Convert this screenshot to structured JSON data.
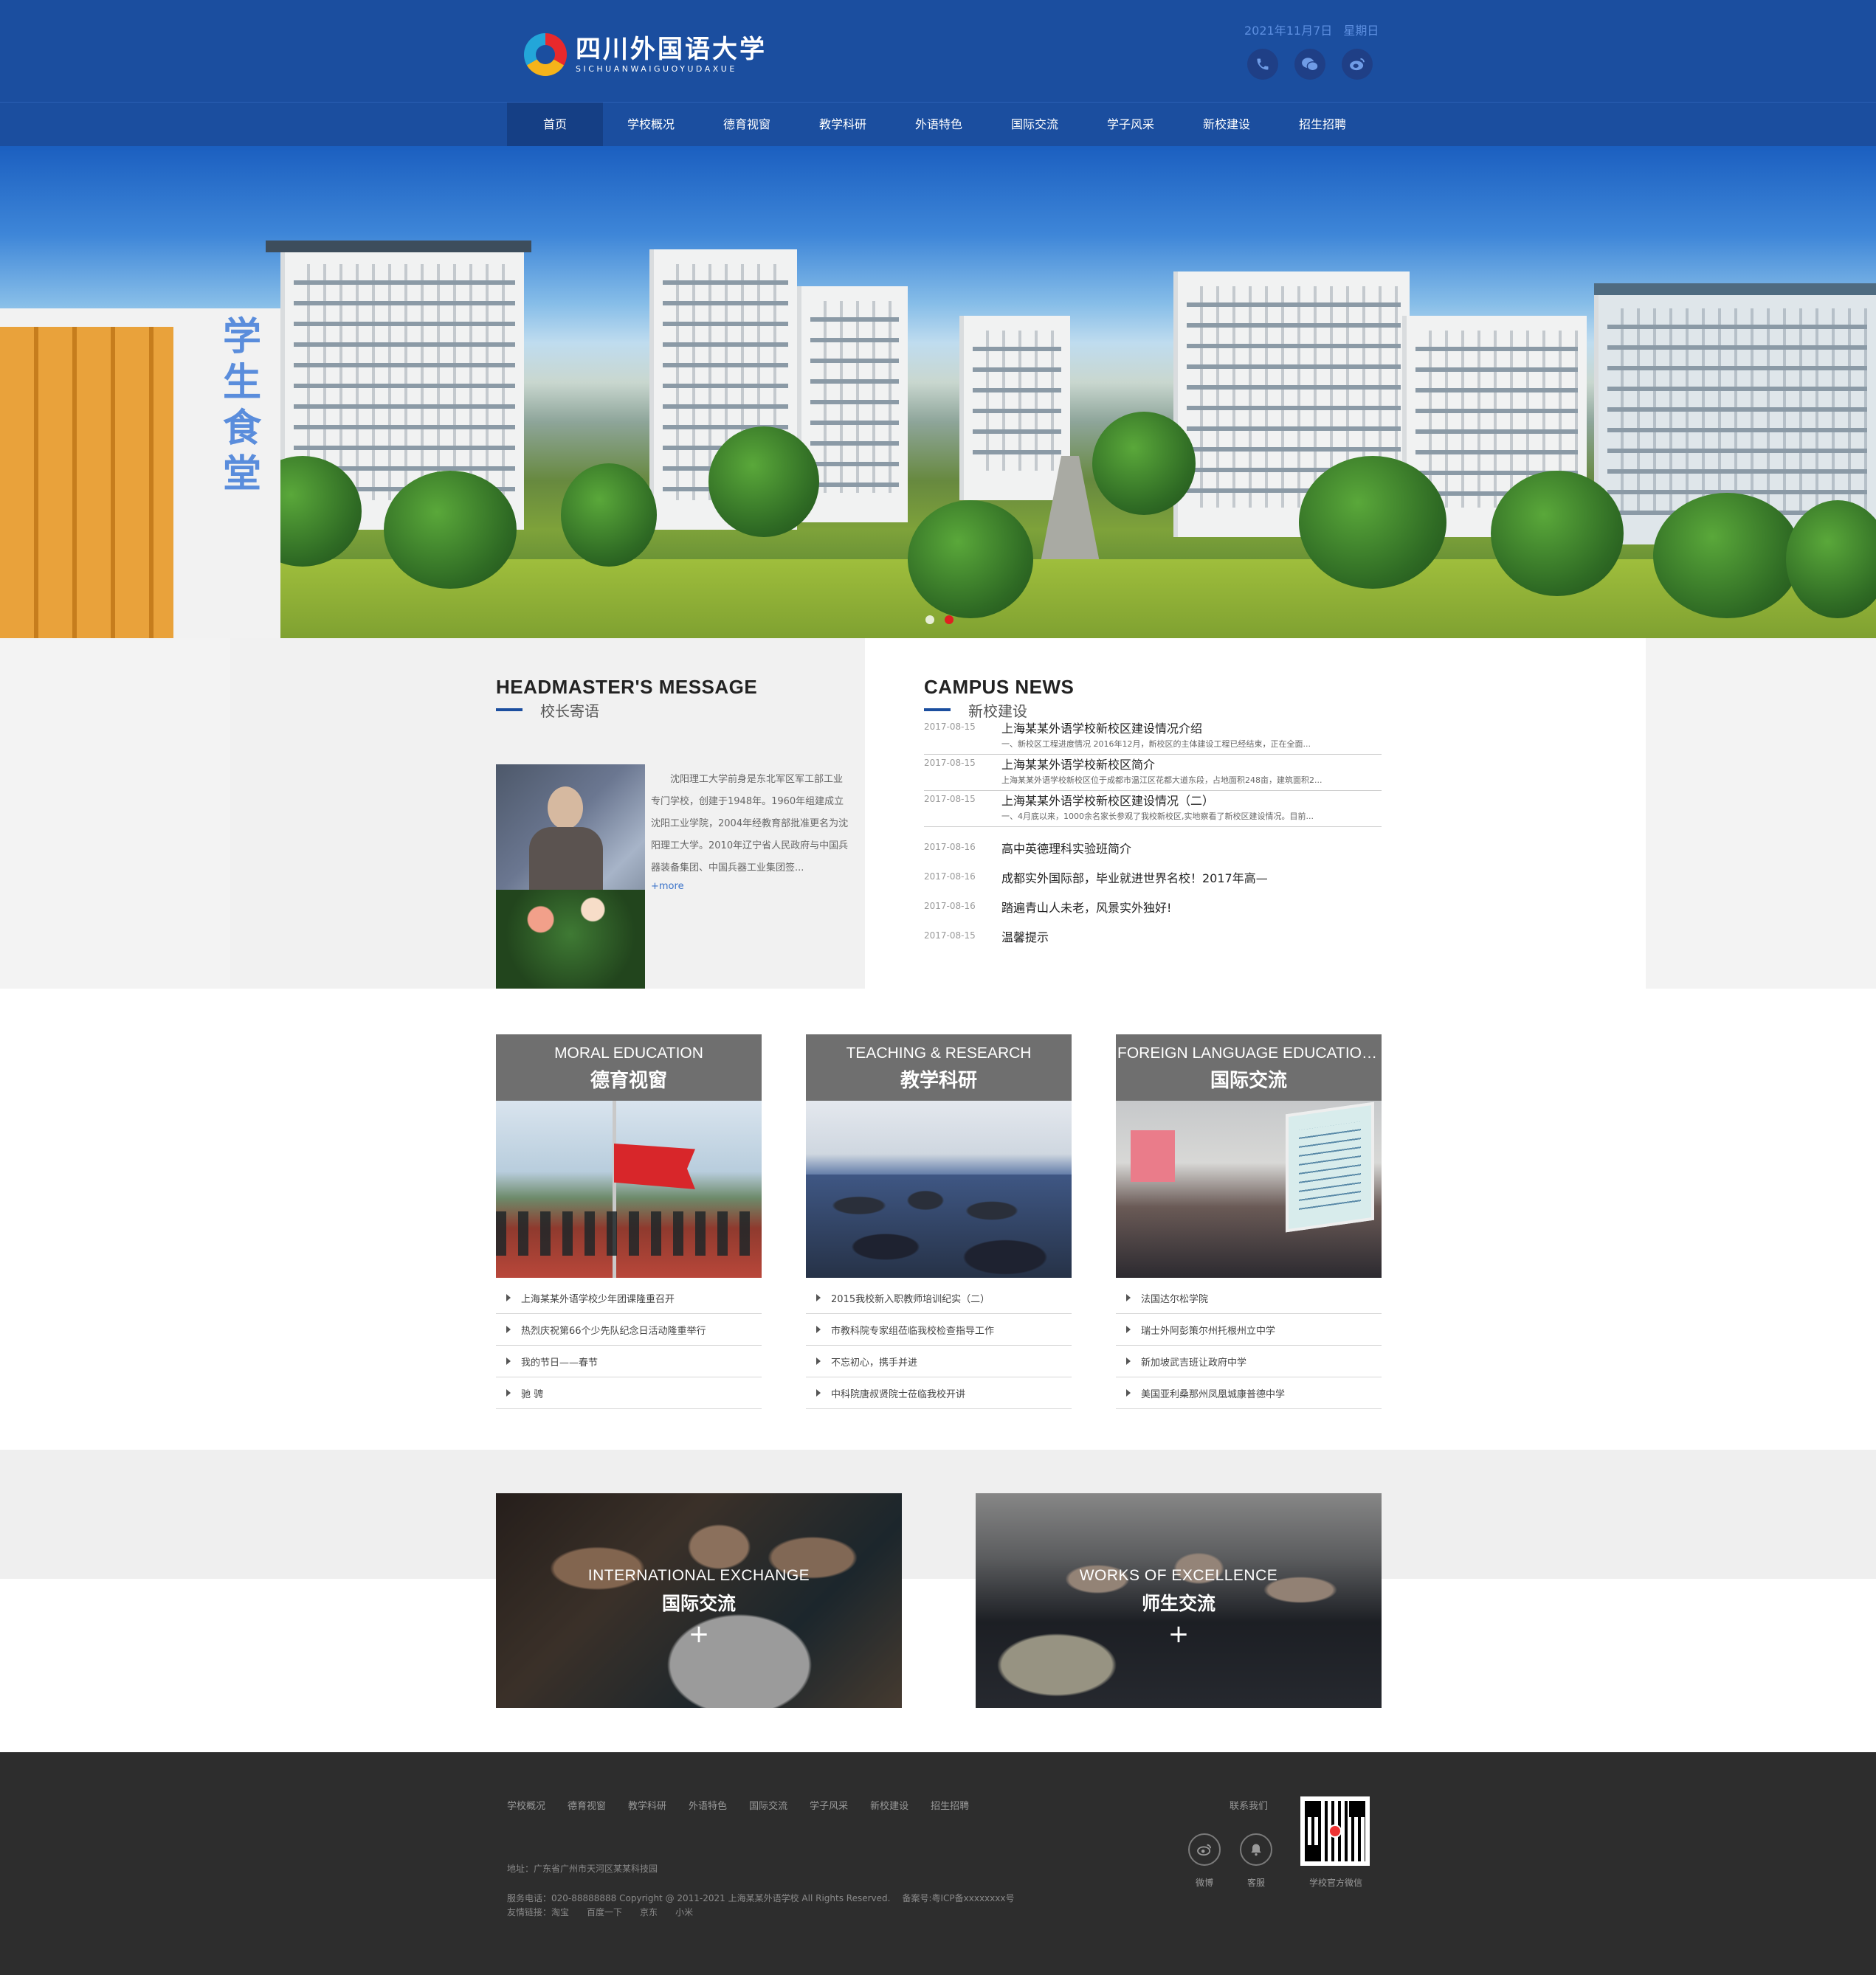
{
  "header": {
    "logo_cn": "四川外国语大学",
    "logo_en": "SICHUANWAIGUOYUDAXUE",
    "date": "2021年11月7日",
    "weekday": "星期日",
    "icons": [
      "phone-icon",
      "wechat-icon",
      "weibo-icon"
    ]
  },
  "nav": {
    "items": [
      "首页",
      "学校概况",
      "德育视窗",
      "教学科研",
      "外语特色",
      "国际交流",
      "学子风采",
      "新校建设",
      "招生招聘"
    ],
    "active_index": 0
  },
  "banner": {
    "sign": "学生食堂",
    "slide_count": 2,
    "active_slide": 1
  },
  "headmaster": {
    "title_en": "HEADMASTER'S MESSAGE",
    "title_cn": "校长寄语",
    "text": "沈阳理工大学前身是东北军区军工部工业专门学校，创建于1948年。1960年组建成立沈阳工业学院，2004年经教育部批准更名为沈阳理工大学。2010年辽宁省人民政府与中国兵器装备集团、中国兵器工业集团签...",
    "more": "+more"
  },
  "news": {
    "title_en": "CAMPUS NEWS",
    "title_cn": "新校建设",
    "major": [
      {
        "date": "2017-08-15",
        "title": "上海某某外语学校新校区建设情况介绍",
        "summary": "一、新校区工程进度情况 2016年12月，新校区的主体建设工程已经结束，正在全面..."
      },
      {
        "date": "2017-08-15",
        "title": "上海某某外语学校新校区简介",
        "summary": "上海某某外语学校新校区位于成都市温江区花都大道东段，占地面积248亩，建筑面积2..."
      },
      {
        "date": "2017-08-15",
        "title": "上海某某外语学校新校区建设情况（二）",
        "summary": "一、4月底以来，1000余名家长参观了我校新校区,实地察看了新校区建设情况。目前..."
      }
    ],
    "minor": [
      {
        "date": "2017-08-16",
        "title": "高中英德理科实验班简介"
      },
      {
        "date": "2017-08-16",
        "title": "成都实外国际部，毕业就进世界名校！2017年高—"
      },
      {
        "date": "2017-08-16",
        "title": "踏遍青山人未老，风景实外独好!"
      },
      {
        "date": "2017-08-15",
        "title": "温馨提示"
      }
    ]
  },
  "cards": [
    {
      "en": "MORAL EDUCATION",
      "cn": "德育视窗",
      "items": [
        "上海某某外语学校少年团课隆重召开",
        "热烈庆祝第66个少先队纪念日活动隆重举行",
        "我的节日——春节",
        "驰 骋"
      ]
    },
    {
      "en": "TEACHING & RESEARCH",
      "cn": "教学科研",
      "items": [
        "2015我校新入职教师培训纪实（二）",
        "市教科院专家组莅临我校检查指导工作",
        "不忘初心，携手并进",
        "中科院唐叔贤院士莅临我校开讲"
      ]
    },
    {
      "en": "FOREIGN LANGUAGE EDUCATION ...",
      "cn": "国际交流",
      "items": [
        "法国达尔松学院",
        "瑞士外阿彭策尔州托根州立中学",
        "新加坡武吉班让政府中学",
        "美国亚利桑那州凤凰城康普德中学"
      ]
    }
  ],
  "panels": [
    {
      "en": "INTERNATIONAL EXCHANGE",
      "cn": "国际交流",
      "plus": "+"
    },
    {
      "en": "WORKS OF EXCELLENCE",
      "cn": "师生交流",
      "plus": "+"
    }
  ],
  "footer": {
    "nav": [
      "学校概况",
      "德育视窗",
      "教学科研",
      "外语特色",
      "国际交流",
      "学子风采",
      "新校建设",
      "招生招聘"
    ],
    "address": "地址：广东省广州市天河区某某科技园",
    "phone": "服务电话：020-88888888 Copyright @ 2011-2021 上海某某外语学校 All Rights Reserved.",
    "icp": "备案号:粤ICP备xxxxxxxx号",
    "links_label": "友情链接：",
    "links": [
      "淘宝",
      "百度一下",
      "京东",
      "小米"
    ],
    "contact_label": "联系我们",
    "weibo_label": "微博",
    "service_label": "客服",
    "qr_label": "学校官方微信"
  },
  "colors": {
    "brand_blue": "#1b4e9f",
    "nav_active": "#153f85",
    "footer_bg": "#2d2d2d",
    "card_head": "#6f6f6f"
  }
}
